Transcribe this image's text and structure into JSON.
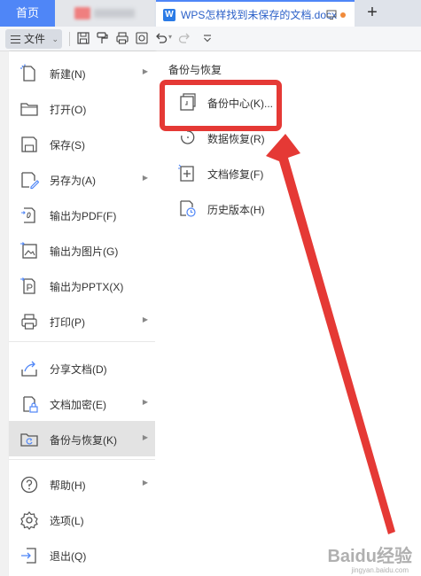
{
  "tabs": {
    "home_label": "首页",
    "doc_title": "WPS怎样找到未保存的文档.docx",
    "doc_icon_letter": "W",
    "add_tab_glyph": "+"
  },
  "toolbar": {
    "file_label": "文件",
    "icons": [
      "save-icon",
      "format-painter-icon",
      "print-icon",
      "print-preview-icon",
      "undo-icon",
      "redo-icon",
      "more-icon"
    ]
  },
  "file_menu": {
    "items": [
      {
        "label": "新建(N)",
        "icon": "new-file-icon",
        "has_submenu": true
      },
      {
        "label": "打开(O)",
        "icon": "folder-icon",
        "has_submenu": false
      },
      {
        "label": "保存(S)",
        "icon": "save-icon",
        "has_submenu": false
      },
      {
        "label": "另存为(A)",
        "icon": "save-as-icon",
        "has_submenu": true
      },
      {
        "label": "输出为PDF(F)",
        "icon": "pdf-export-icon",
        "has_submenu": false
      },
      {
        "label": "输出为图片(G)",
        "icon": "image-export-icon",
        "has_submenu": false
      },
      {
        "label": "输出为PPTX(X)",
        "icon": "pptx-export-icon",
        "has_submenu": false
      },
      {
        "label": "打印(P)",
        "icon": "printer-icon",
        "has_submenu": true
      },
      {
        "label": "分享文档(D)",
        "icon": "share-icon",
        "has_submenu": false
      },
      {
        "label": "文档加密(E)",
        "icon": "encrypt-icon",
        "has_submenu": true
      },
      {
        "label": "备份与恢复(K)",
        "icon": "backup-icon",
        "has_submenu": true,
        "active": true
      },
      {
        "label": "帮助(H)",
        "icon": "help-icon",
        "has_submenu": true
      },
      {
        "label": "选项(L)",
        "icon": "settings-icon",
        "has_submenu": false
      },
      {
        "label": "退出(Q)",
        "icon": "exit-icon",
        "has_submenu": false
      }
    ]
  },
  "submenu": {
    "title": "备份与恢复",
    "items": [
      {
        "label": "备份中心(K)...",
        "icon": "backup-center-icon"
      },
      {
        "label": "数据恢复(R)",
        "icon": "data-recovery-icon"
      },
      {
        "label": "文档修复(F)",
        "icon": "doc-repair-icon"
      },
      {
        "label": "历史版本(H)",
        "icon": "history-icon"
      }
    ]
  },
  "annotation": {
    "highlight_color": "#e53935",
    "highlighted_item": "备份中心(K)..."
  },
  "watermark": {
    "text": "Baidu经验",
    "subtext": "jingyan.baidu.com"
  },
  "colors": {
    "accent": "#4f86f7",
    "active_bg": "#e3e3e3",
    "annotation_red": "#e53935"
  }
}
